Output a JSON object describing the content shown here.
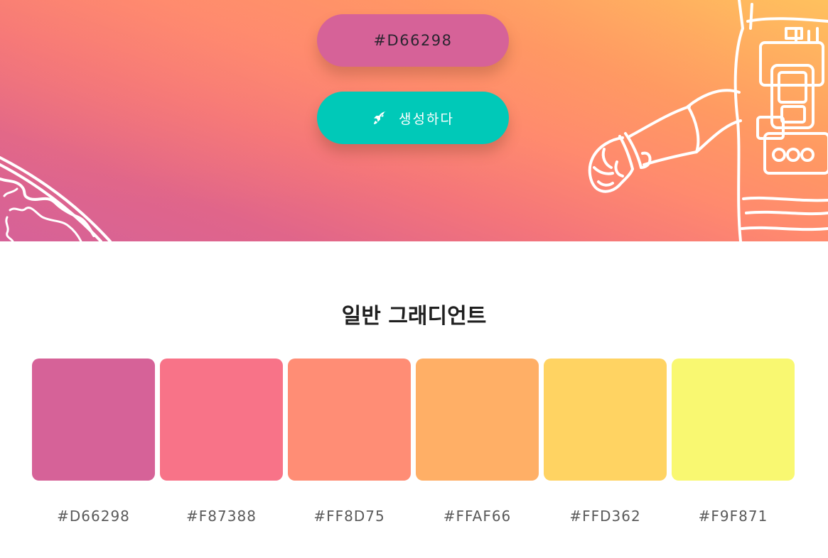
{
  "hero": {
    "color_input_value": "#D66298",
    "color_input_bg": "#D66298",
    "generate_label": "생성하다",
    "generate_bg": "#00C9B8"
  },
  "section": {
    "title": "일반 그래디언트"
  },
  "swatches": [
    {
      "hex": "#D66298",
      "label": "#D66298"
    },
    {
      "hex": "#F87388",
      "label": "#F87388"
    },
    {
      "hex": "#FF8D75",
      "label": "#FF8D75"
    },
    {
      "hex": "#FFAF66",
      "label": "#FFAF66"
    },
    {
      "hex": "#FFD362",
      "label": "#FFD362"
    },
    {
      "hex": "#F9F871",
      "label": "#F9F871"
    }
  ]
}
